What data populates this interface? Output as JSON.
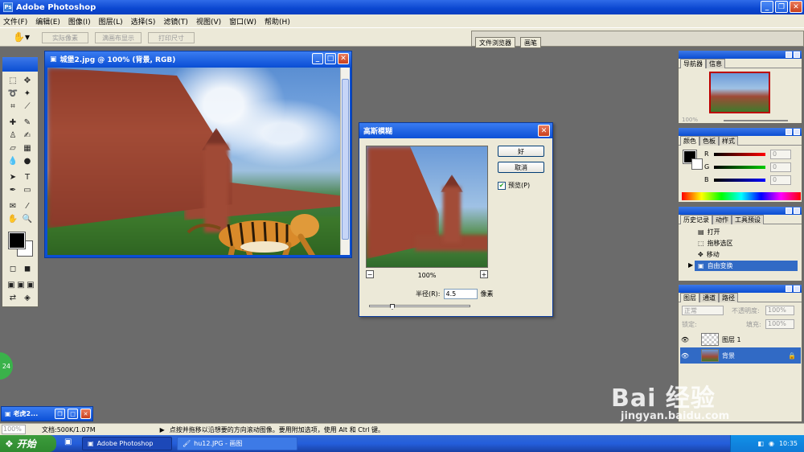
{
  "app": {
    "title": "Adobe Photoshop"
  },
  "menu": [
    "文件(F)",
    "编辑(E)",
    "图像(I)",
    "图层(L)",
    "选择(S)",
    "滤镜(T)",
    "视图(V)",
    "窗口(W)",
    "帮助(H)"
  ],
  "options": {
    "btn1": "实际像素",
    "btn2": "满画布显示",
    "btn3": "打印尺寸",
    "well_tab1": "文件浏览器",
    "well_tab2": "画笔"
  },
  "document": {
    "title": "城堡2.jpg @ 100% (背景, RGB)"
  },
  "dialog": {
    "title": "高斯模糊",
    "ok": "好",
    "cancel": "取消",
    "preview": "预览(P)",
    "preview_checked": true,
    "zoom": "100%",
    "radius_label": "半径(R):",
    "radius_value": "4.5",
    "unit": "像素",
    "slider_level": 0.2
  },
  "navigator": {
    "tab1": "导航器",
    "tab2": "信息",
    "zoom": "100%"
  },
  "color": {
    "tab1": "颜色",
    "tab2": "色板",
    "tab3": "样式",
    "r": "R",
    "g": "G",
    "b": "B",
    "r_val": "0",
    "g_val": "0",
    "b_val": "0"
  },
  "history": {
    "tab1": "历史记录",
    "tab2": "动作",
    "tab3": "工具预设",
    "items": [
      "打开",
      "拖移选区",
      "移动",
      "自由变换"
    ]
  },
  "layers": {
    "tab1": "图层",
    "tab2": "通道",
    "tab3": "路径",
    "mode": "正常",
    "opacity_label": "不透明度:",
    "opacity": "100%",
    "lock_label": "锁定:",
    "fill_label": "填充:",
    "fill": "100%",
    "layer1": "图层 1",
    "background": "背景"
  },
  "minimized": {
    "title": "老虎2..."
  },
  "badge": "24",
  "status": {
    "zoom": "100%",
    "doc": "文档:500K/1.07M",
    "hint": "点按并拖移以沿想要的方向滚动图像。要用附加选项，使用 Alt 和 Ctrl 键。"
  },
  "taskbar": {
    "start": "开始",
    "task1": "Adobe Photoshop",
    "task2": "hu12.JPG - 画图",
    "clock": "10:35"
  },
  "watermark": {
    "big": "Bai 经验",
    "small": "jingyan.baidu.com"
  }
}
